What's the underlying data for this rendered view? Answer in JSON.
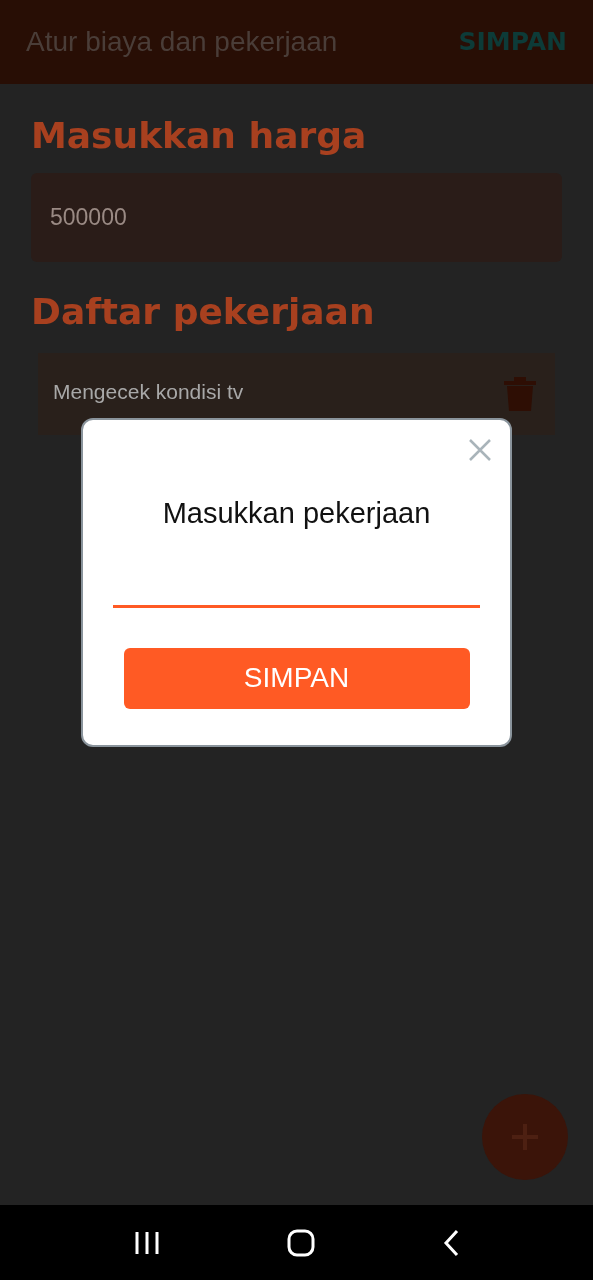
{
  "app_bar": {
    "title": "Atur biaya dan pekerjaan",
    "action": "SIMPAN"
  },
  "price_section": {
    "heading": "Masukkan harga",
    "value": "500000"
  },
  "jobs_section": {
    "heading": "Daftar pekerjaan",
    "items": [
      {
        "text": "Mengecek kondisi tv"
      }
    ]
  },
  "dialog": {
    "title": "Masukkan pekerjaan",
    "button": "SIMPAN"
  }
}
